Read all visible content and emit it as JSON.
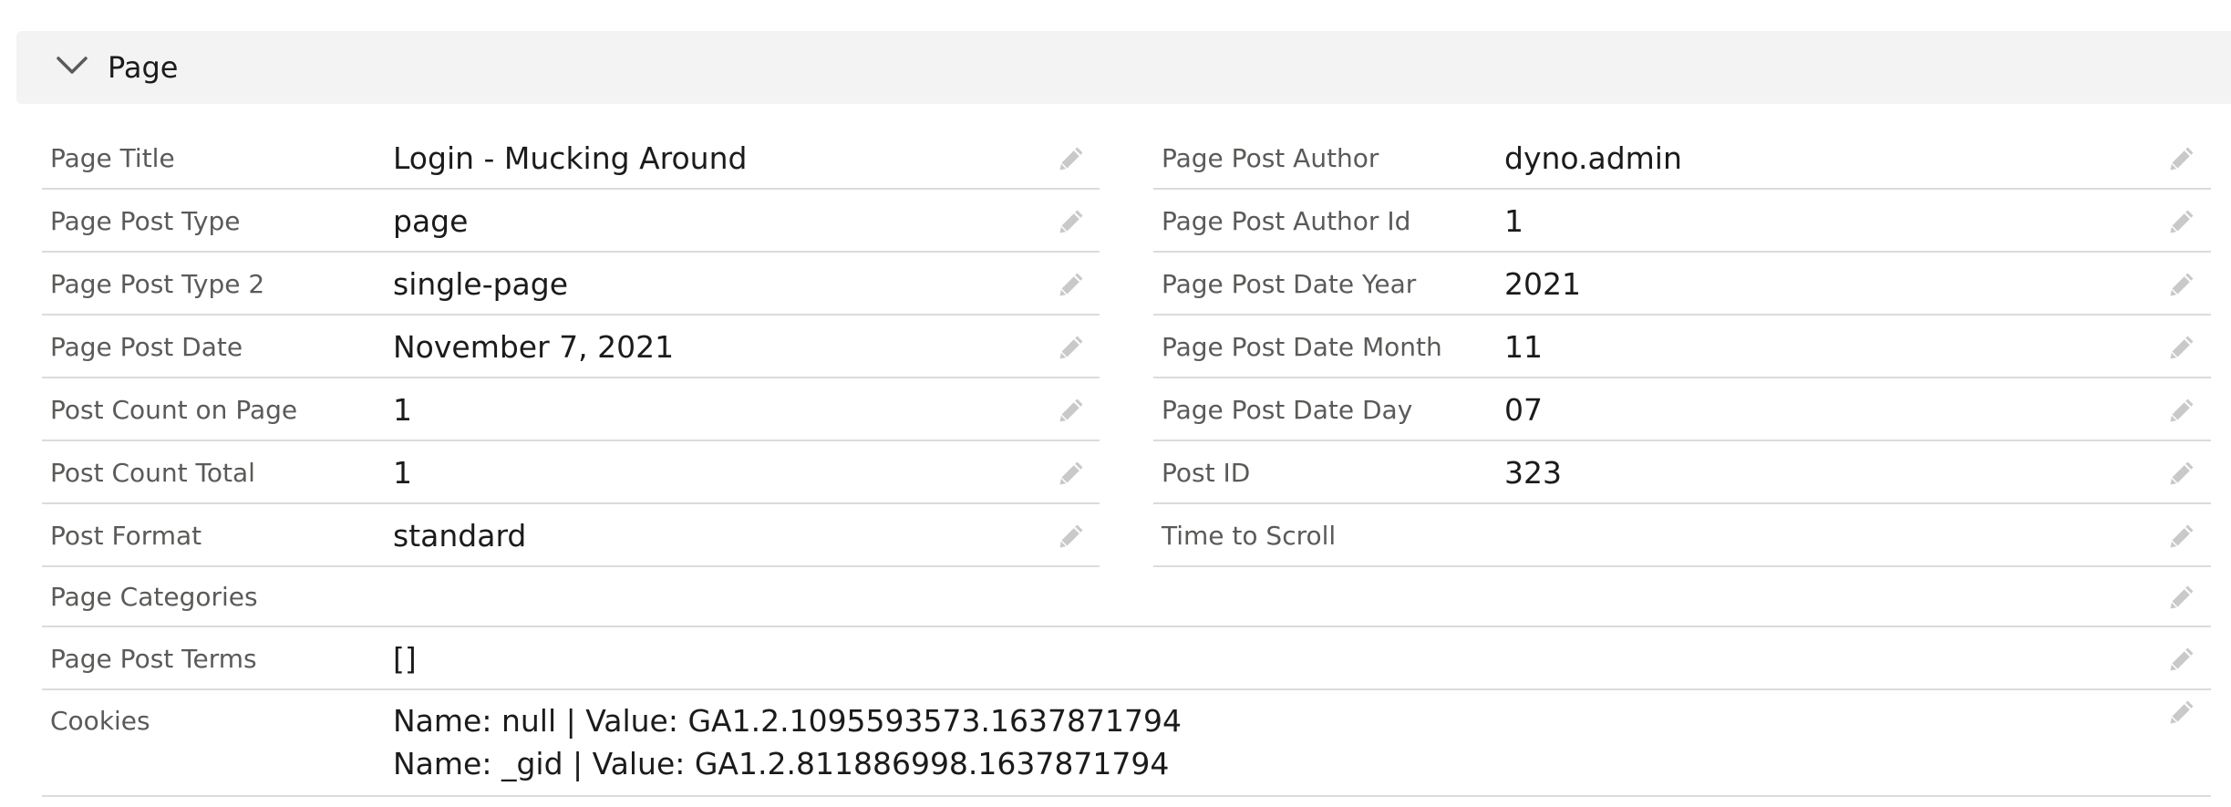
{
  "section": {
    "title": "Page"
  },
  "left_fields": [
    {
      "label": "Page Title",
      "value": "Login - Mucking Around"
    },
    {
      "label": "Page Post Type",
      "value": "page"
    },
    {
      "label": "Page Post Type 2",
      "value": "single-page"
    },
    {
      "label": "Page Post Date",
      "value": "November 7, 2021"
    },
    {
      "label": "Post Count on Page",
      "value": "1"
    },
    {
      "label": "Post Count Total",
      "value": "1"
    },
    {
      "label": "Post Format",
      "value": "standard"
    }
  ],
  "right_fields": [
    {
      "label": "Page Post Author",
      "value": "dyno.admin"
    },
    {
      "label": "Page Post Author Id",
      "value": "1"
    },
    {
      "label": "Page Post Date Year",
      "value": "2021"
    },
    {
      "label": "Page Post Date Month",
      "value": "11"
    },
    {
      "label": "Page Post Date Day",
      "value": "07"
    },
    {
      "label": "Post ID",
      "value": "323"
    },
    {
      "label": "Time to Scroll",
      "value": ""
    }
  ],
  "full_fields": [
    {
      "label": "Page Categories",
      "value": ""
    },
    {
      "label": "Page Post Terms",
      "value": "[]"
    }
  ],
  "cookies": {
    "label": "Cookies",
    "lines": [
      "Name: null | Value: GA1.2.1095593573.1637871794",
      "Name: _gid | Value: GA1.2.811886998.1637871794"
    ]
  },
  "icons": {
    "section_toggle": "chevron-down-icon",
    "edit": "pencil-icon"
  },
  "colors": {
    "header_bg": "#f3f3f3",
    "divider": "#dddbda",
    "label_text": "#5a5a58",
    "value_text": "#1b1b1b",
    "edit_icon": "#c9c9c9"
  }
}
